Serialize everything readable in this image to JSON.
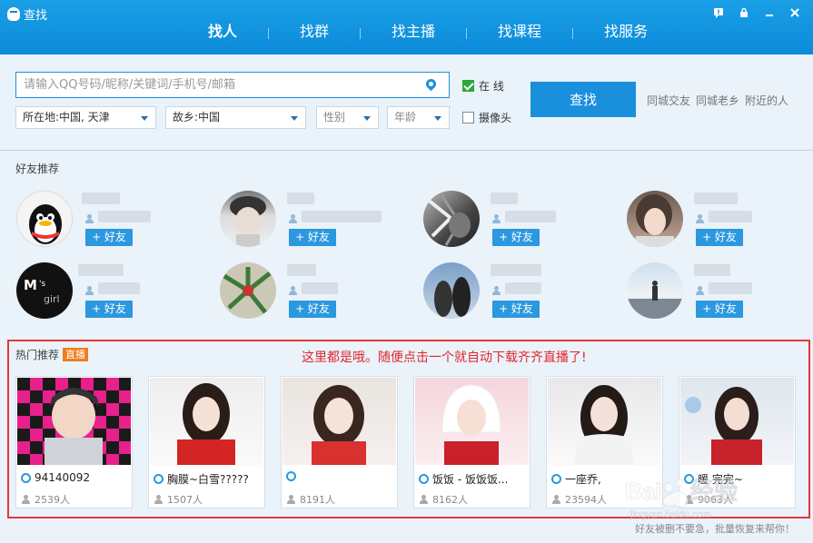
{
  "window": {
    "title": "查找"
  },
  "nav": {
    "tabs": [
      "找人",
      "找群",
      "找主播",
      "找课程",
      "找服务"
    ],
    "active_index": 0
  },
  "search": {
    "placeholder": "请输入QQ号码/昵称/关键词/手机号/邮箱",
    "location_label": "所在地:中国, 天津",
    "hometown_label": "故乡:中国",
    "gender_label": "性别",
    "age_label": "年龄",
    "online_label": "在  线",
    "online_checked": true,
    "camera_label": "摄像头",
    "camera_checked": false,
    "button_label": "查找",
    "quick_links": [
      "同城交友",
      "同城老乡",
      "附近的人"
    ]
  },
  "friends_section": {
    "title": "好友推荐",
    "add_label": "+ 好友",
    "count": 8
  },
  "hot_section": {
    "title": "热门推荐",
    "badge": "直播",
    "annotation": "这里都是哦。随便点击一个就自动下载齐齐直播了!",
    "cards": [
      {
        "name": "94140092",
        "viewers": "2539人"
      },
      {
        "name": "胸膜~白雪?????",
        "viewers": "1507人"
      },
      {
        "name": "",
        "viewers": "8191人"
      },
      {
        "name": "饭饭 - 饭饭饭...",
        "viewers": "8162人"
      },
      {
        "name": "一座乔,",
        "viewers": "23594人"
      },
      {
        "name": "暖 完完~",
        "viewers": "9063人"
      }
    ]
  },
  "footer": {
    "link": "好友被删不要急，批量恢复来帮你！"
  },
  "watermark": {
    "brand": "Baidu",
    "brand_cn": "经验",
    "url": "jingyan.baidu.com"
  },
  "colors": {
    "header": "#0b8ad9",
    "accent": "#1a8fdc",
    "annotation": "#e0262a",
    "live_badge": "#f07c1c"
  }
}
